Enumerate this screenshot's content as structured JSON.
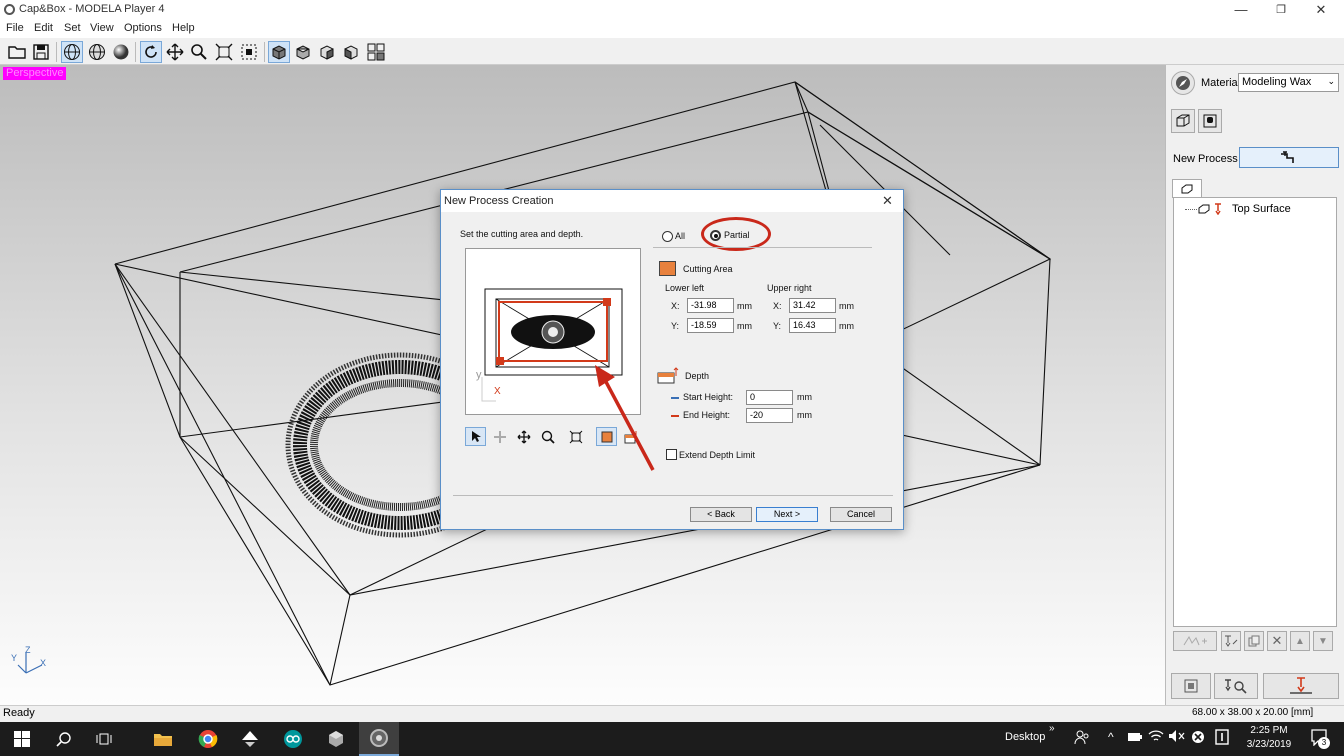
{
  "window": {
    "title": "Cap&Box - MODELA Player 4",
    "minimize": "—",
    "maximize": "❐",
    "close": "✕"
  },
  "menu": [
    "File",
    "Edit",
    "Set",
    "View",
    "Options",
    "Help"
  ],
  "toolbar": {
    "icons": [
      "open-icon",
      "save-icon",
      "globe-wire-icon",
      "globe-icon",
      "sphere-icon",
      "rotate-icon",
      "pan-icon",
      "zoom-icon",
      "fit-icon",
      "zoom-box-icon",
      "cube-front-icon",
      "cube-top-icon",
      "cube-side-icon",
      "cube-iso-icon",
      "quad-view-icon"
    ]
  },
  "viewport": {
    "view_label": "Perspective",
    "axis_y": "Y",
    "axis_z": "Z",
    "axis_x": "X"
  },
  "right_panel": {
    "material_label": "Material",
    "material_value": "Modeling Wax",
    "new_process_label": "New Process",
    "tree_items": [
      {
        "label": "Top Surface"
      }
    ]
  },
  "dialog": {
    "title": "New Process Creation",
    "instruction": "Set the cutting area and depth.",
    "radio_all": "All",
    "radio_partial": "Partial",
    "partial_selected": true,
    "cutting_area_label": "Cutting Area",
    "lower_left_label": "Lower left",
    "upper_right_label": "Upper right",
    "x_label": "X:",
    "y_label": "Y:",
    "unit": "mm",
    "lower_left_x": "-31.98",
    "lower_left_y": "-18.59",
    "upper_right_x": "31.42",
    "upper_right_y": "16.43",
    "depth_label": "Depth",
    "start_height_label": "Start Height:",
    "start_height_value": "0",
    "end_height_label": "End Height:",
    "end_height_value": "-20",
    "extend_depth_label": "Extend Depth Limit",
    "extend_depth_checked": false,
    "preview_y": "y",
    "preview_x": "X",
    "back_button": "< Back",
    "next_button": "Next >",
    "cancel_button": "Cancel"
  },
  "status": {
    "left": "Ready",
    "right": "68.00 x 38.00 x 20.00 [mm]"
  },
  "taskbar": {
    "desktop_label": "Desktop",
    "chevron": "»",
    "time": "2:25 PM",
    "date": "3/23/2019",
    "notification_count": "3"
  },
  "colors": {
    "accent_red": "#d23a1a",
    "perspective_bg": "#ff00ff",
    "dialog_border": "#5a8fc8",
    "taskbar": "#1c1c1c"
  }
}
